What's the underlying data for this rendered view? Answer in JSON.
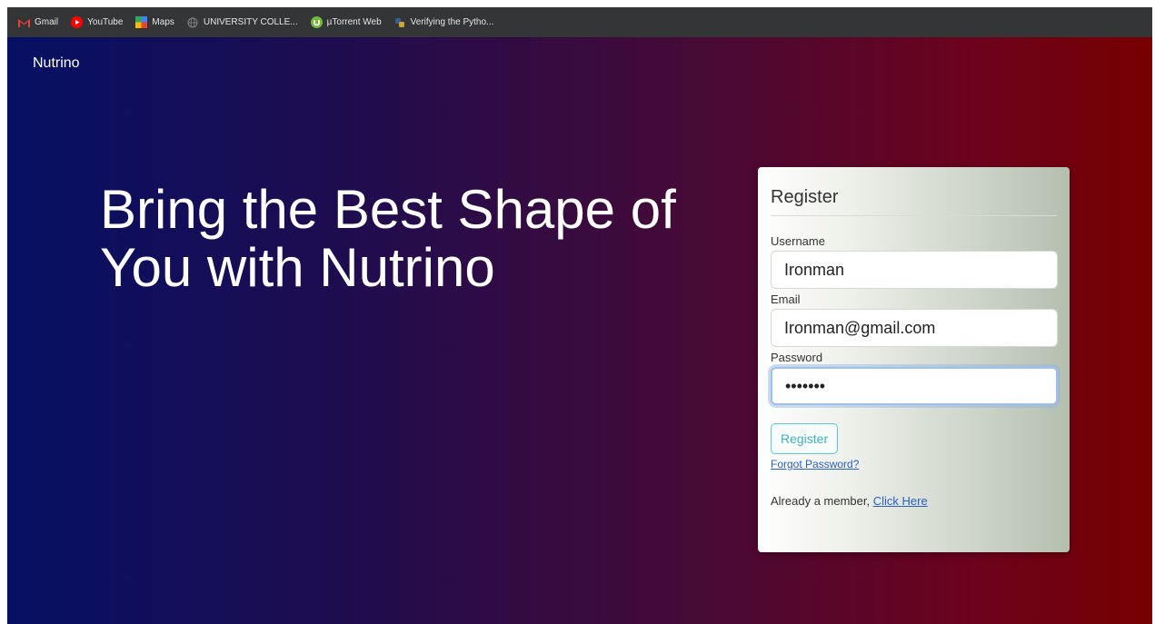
{
  "bookmarks": [
    {
      "label": "Gmail",
      "icon": "gmail-icon"
    },
    {
      "label": "YouTube",
      "icon": "youtube-icon"
    },
    {
      "label": "Maps",
      "icon": "maps-icon"
    },
    {
      "label": "UNIVERSITY COLLE...",
      "icon": "globe-icon"
    },
    {
      "label": "µTorrent Web",
      "icon": "utorrent-icon"
    },
    {
      "label": "Verifying the Pytho...",
      "icon": "python-icon"
    }
  ],
  "brand": "Nutrino",
  "hero": {
    "line1": "Bring the Best Shape of",
    "line2": "You with Nutrino"
  },
  "form": {
    "title": "Register",
    "username_label": "Username",
    "username_value": "Ironman",
    "email_label": "Email",
    "email_value": "Ironman@gmail.com",
    "password_label": "Password",
    "password_value": "•••••••",
    "register_button": "Register",
    "forgot_link": "Forgot Password?",
    "member_text": "Already a member, ",
    "member_link": "Click Here"
  },
  "colors": {
    "gradient_left": "#061063",
    "gradient_right": "#760000",
    "link": "#2a60c9",
    "button": "#3fb3c0"
  }
}
